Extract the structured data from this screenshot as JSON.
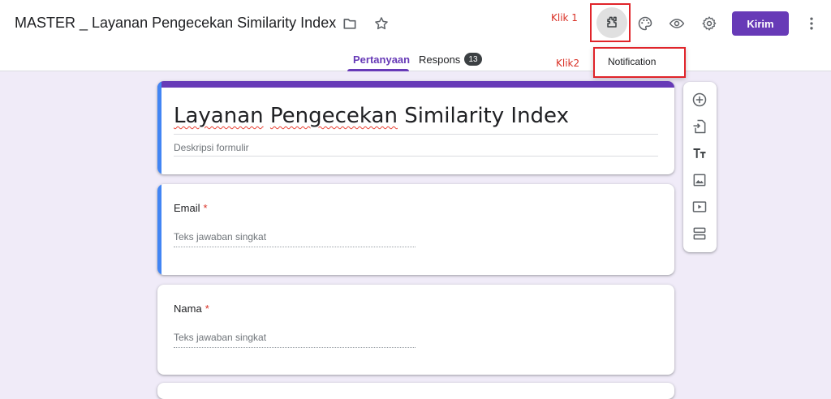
{
  "header": {
    "doc_title": "MASTER _ Layanan Pengecekan Similarity Index",
    "send_label": "Kirim",
    "annotation_1": "Klik 1",
    "annotation_2": "Klik2"
  },
  "tabs": [
    {
      "label": "Pertanyaan",
      "active": true
    },
    {
      "label": "Respons",
      "active": false,
      "badge": "13"
    }
  ],
  "popup": {
    "item": "Notification"
  },
  "form": {
    "title_word1": "Layanan",
    "title_word2": "Pengecekan",
    "title_rest": "Similarity Index",
    "description_placeholder": "Deskripsi formulir"
  },
  "questions": [
    {
      "label": "Email",
      "required_mark": "*",
      "placeholder": "Teks jawaban singkat"
    },
    {
      "label": "Nama",
      "required_mark": "*",
      "placeholder": "Teks jawaban singkat"
    }
  ],
  "icons": {
    "header": [
      "folder-icon",
      "star-icon",
      "addon-puzzle-icon",
      "palette-icon",
      "preview-eye-icon",
      "settings-gear-icon",
      "more-vert-icon"
    ],
    "toolbar": [
      "add-question-icon",
      "import-questions-icon",
      "add-title-icon",
      "add-image-icon",
      "add-video-icon",
      "add-section-icon"
    ]
  },
  "colors": {
    "accent": "#673ab7",
    "background": "#f0ebf8",
    "focus_bar": "#4285f4",
    "annotation_red": "#e0242a",
    "required": "#d93025"
  }
}
